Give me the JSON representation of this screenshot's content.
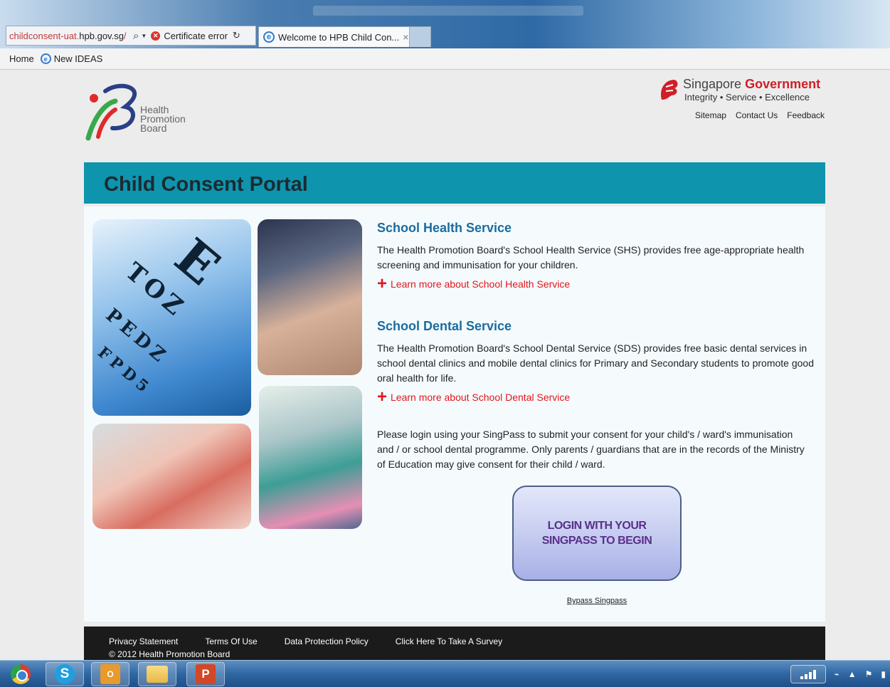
{
  "browser": {
    "address_url_prefix": "childconsent-uat.",
    "address_url_domain": "hpb.gov.sg",
    "address_url_suffix": "/",
    "certificate_error": "Certificate error",
    "tab_title": "Welcome to HPB Child Con...",
    "favorites": [
      "Home",
      "New IDEAS"
    ]
  },
  "header": {
    "logo_lines": [
      "Health",
      "Promotion",
      "Board"
    ],
    "sg_title_prefix": "Singapore ",
    "sg_title_gov": "Government",
    "sg_tagline": "Integrity  •  Service  •  Excellence",
    "links": [
      "Sitemap",
      "Contact Us",
      "Feedback"
    ]
  },
  "banner": {
    "title": "Child Consent Portal"
  },
  "shs": {
    "title": "School Health Service",
    "body": "The Health Promotion Board's School Health Service (SHS) provides free age-appropriate health screening and immunisation for your children.",
    "link": "Learn more about School Health Service"
  },
  "sds": {
    "title": "School Dental Service",
    "body": "The Health Promotion Board's School Dental Service (SDS) provides free basic dental services in school dental clinics and mobile dental clinics for Primary and Secondary students to promote good oral health for life.",
    "link": "Learn more about School Dental Service"
  },
  "login": {
    "note": "Please login using your SingPass to submit your consent for your child's / ward's immunisation and / or school dental programme. Only parents / guardians that are in the records of the Ministry of Education may give consent for their child / ward.",
    "button_label": "LOGIN WITH YOUR\nSINGPASS TO BEGIN",
    "bypass": "Bypass Singpass"
  },
  "footer": {
    "links": [
      "Privacy Statement",
      "Terms Of Use",
      "Data Protection Policy",
      "Click Here To Take A Survey"
    ],
    "copyright": "© 2012 Health Promotion Board"
  },
  "taskbar": {
    "outlook_label": "O",
    "skype_label": "S",
    "ppt_label": "P"
  },
  "colors": {
    "banner": "#0e95ad",
    "section_title": "#1a6c9f",
    "link_red": "#e1161c",
    "login_text": "#5a2f8c"
  }
}
